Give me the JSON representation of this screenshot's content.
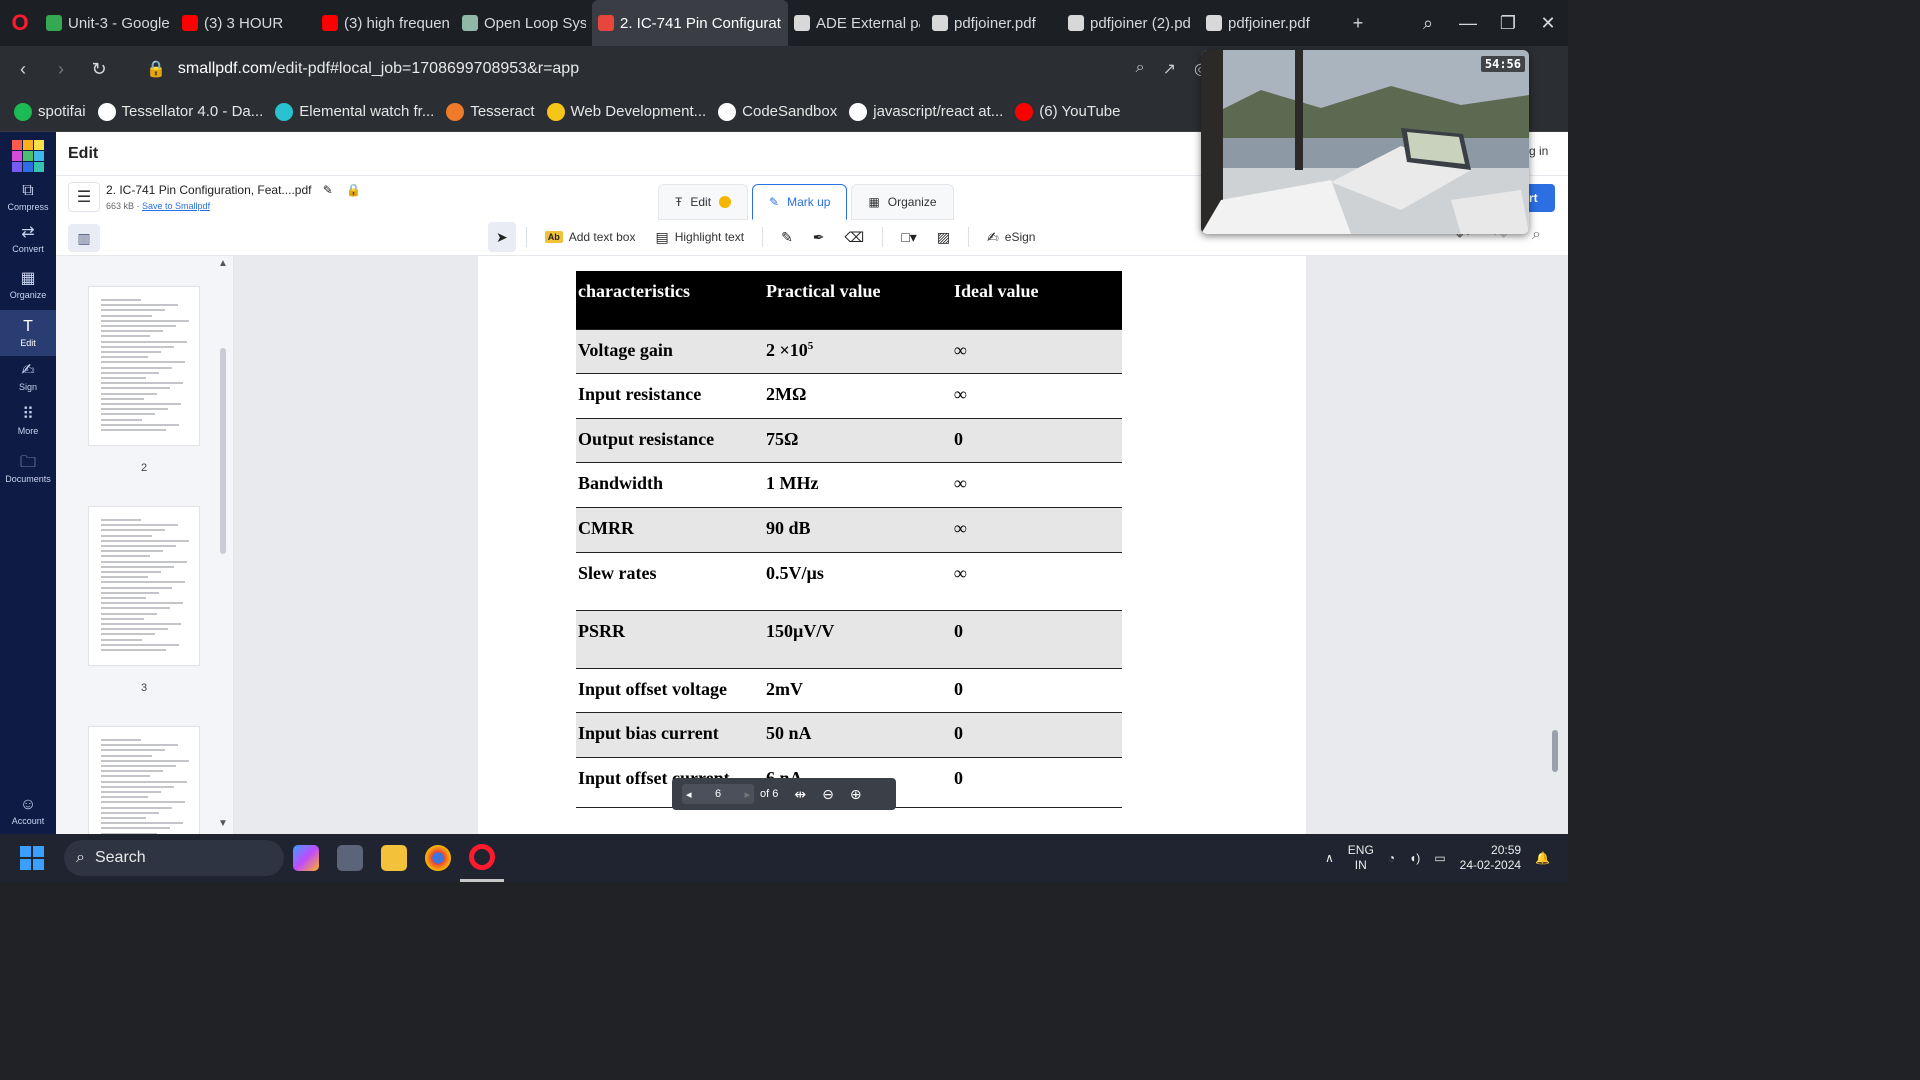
{
  "browser": {
    "tabs": [
      {
        "label": "Unit-3 - Google",
        "icon": "google-drive-icon",
        "active": false
      },
      {
        "label": "(3) 3 HOUR",
        "icon": "youtube-icon",
        "active": false
      },
      {
        "label": "(3) high frequen",
        "icon": "youtube-icon",
        "active": false
      },
      {
        "label": "Open Loop Syst",
        "icon": "chatgpt-icon",
        "active": false
      },
      {
        "label": "2. IC-741 Pin Configurat",
        "icon": "smallpdf-icon",
        "active": true
      },
      {
        "label": "ADE External pa",
        "icon": "globe-icon",
        "active": false
      },
      {
        "label": "pdfjoiner.pdf",
        "icon": "globe-icon",
        "active": false
      },
      {
        "label": "pdfjoiner (2).pd",
        "icon": "globe-icon",
        "active": false
      },
      {
        "label": "pdfjoiner.pdf",
        "icon": "globe-icon",
        "active": false
      }
    ],
    "url_domain": "smallpdf.com",
    "url_path": "/edit-pdf#local_job=1708699708953&r=app",
    "bookmarks": [
      {
        "label": "spotifai",
        "color": "#1db954"
      },
      {
        "label": "Tessellator 4.0 - Da...",
        "color": "#ffffff"
      },
      {
        "label": "Elemental watch fr...",
        "color": "#28c2d1"
      },
      {
        "label": "Tesseract",
        "color": "#f07a2c"
      },
      {
        "label": "Web Development...",
        "color": "#f5c518"
      },
      {
        "label": "CodeSandbox",
        "color": "#ffffff"
      },
      {
        "label": "javascript/react at...",
        "color": "#ffffff"
      },
      {
        "label": "(6) YouTube",
        "color": "#ff0000"
      }
    ]
  },
  "app": {
    "header_title": "Edit",
    "rail": [
      {
        "label": "Compress",
        "glyph": "⧉"
      },
      {
        "label": "Convert",
        "glyph": "⇄"
      },
      {
        "label": "Organize",
        "glyph": "▦"
      },
      {
        "label": "Edit",
        "glyph": "T"
      },
      {
        "label": "Sign",
        "glyph": "✍"
      },
      {
        "label": "More",
        "glyph": "⠿"
      },
      {
        "label": "Documents",
        "glyph": "🗀"
      }
    ],
    "account_label": "Account",
    "file_name": "2. IC-741 Pin Configuration, Feat...",
    "file_ext": ".pdf",
    "file_size": "663 kB",
    "save_link": "Save to Smallpdf",
    "modes": [
      {
        "label": "Edit",
        "icon": "text-edit-icon"
      },
      {
        "label": "Mark up",
        "icon": "pen-icon"
      },
      {
        "label": "Organize",
        "icon": "grid-icon"
      }
    ],
    "tools": {
      "add_text": "Add text box",
      "add_text_badge": "Ab",
      "highlight": "Highlight text",
      "esign": "eSign"
    },
    "login_partial": "g in",
    "export_partial": "rt"
  },
  "thumbnails": [
    {
      "page": "2"
    },
    {
      "page": "3"
    },
    {
      "page": ""
    }
  ],
  "document": {
    "headers": [
      "characteristics",
      "Practical value",
      "Ideal value"
    ],
    "rows": [
      {
        "characteristic": "Voltage gain",
        "practical": "2 ×10",
        "practical_sup": "5",
        "ideal": "∞"
      },
      {
        "characteristic": "Input resistance",
        "practical": "2MΩ",
        "practical_sup": "",
        "ideal": "∞"
      },
      {
        "characteristic": "Output resistance",
        "practical": "75Ω",
        "practical_sup": "",
        "ideal": "0"
      },
      {
        "characteristic": "Bandwidth",
        "practical": "1 MHz",
        "practical_sup": "",
        "ideal": "∞"
      },
      {
        "characteristic": "CMRR",
        "practical": "90 dB",
        "practical_sup": "",
        "ideal": "∞"
      },
      {
        "characteristic": "Slew rates",
        "practical": "0.5V/µs",
        "practical_sup": "",
        "ideal": "∞"
      },
      {
        "characteristic": "PSRR",
        "practical": "150µV/V",
        "practical_sup": "",
        "ideal": "0"
      },
      {
        "characteristic": "Input offset voltage",
        "practical": "2mV",
        "practical_sup": "",
        "ideal": "0"
      },
      {
        "characteristic": "Input bias current",
        "practical": "50 nA",
        "practical_sup": "",
        "ideal": "0"
      },
      {
        "characteristic": "Input offset current",
        "practical": "6 nA",
        "practical_sup": "",
        "ideal": "0"
      }
    ]
  },
  "page_nav": {
    "current": "6",
    "of": "of 6"
  },
  "pip": {
    "timer": "54:56"
  },
  "taskbar": {
    "search_placeholder": "Search",
    "lang_line1": "ENG",
    "lang_line2": "IN",
    "time": "20:59",
    "date": "24-02-2024"
  },
  "colors": {
    "accent": "#2b6fe3",
    "rail_bg": "#0d1b45",
    "opera_red": "#ff1b2d"
  }
}
